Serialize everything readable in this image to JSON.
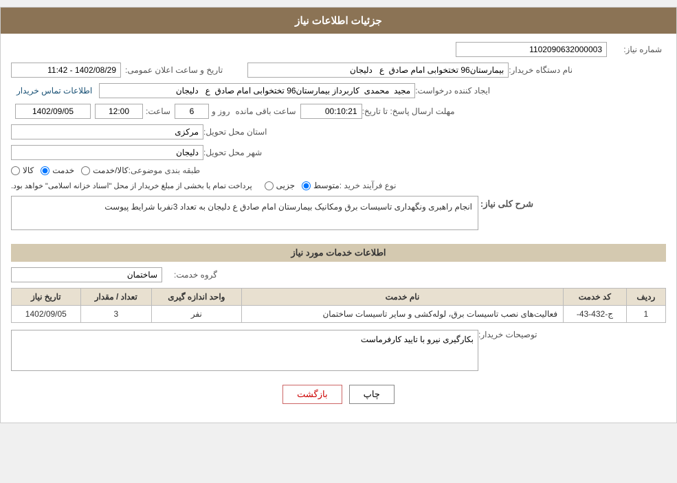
{
  "header": {
    "title": "جزئیات اطلاعات نیاز"
  },
  "fields": {
    "need_number_label": "شماره نیاز:",
    "need_number_value": "1102090632000003",
    "buyer_name_label": "نام دستگاه خریدار:",
    "buyer_name_value": "بیمارستان96 تختخوابی امام صادق  ع   دلیجان",
    "creator_label": "ایجاد کننده درخواست:",
    "creator_value": "مجید  محمدی  کاربرداز بیمارستان96 تختخوابی امام صادق  ع   دلیجان",
    "contact_link": "اطلاعات تماس خریدار",
    "deadline_label": "مهلت ارسال پاسخ: تا تاریخ:",
    "date_value": "1402/09/05",
    "time_label": "ساعت:",
    "time_value": "12:00",
    "days_label": "روز و",
    "days_value": "6",
    "remaining_label": "ساعت باقی مانده",
    "remaining_value": "00:10:21",
    "province_label": "استان محل تحویل:",
    "province_value": "مرکزی",
    "city_label": "شهر محل تحویل:",
    "city_value": "دلیجان",
    "date_announce_label": "تاریخ و ساعت اعلان عمومی:",
    "date_announce_value": "1402/08/29 - 11:42",
    "category_label": "طبقه بندی موضوعی:",
    "category_options": [
      "کالا",
      "خدمت",
      "کالا/خدمت"
    ],
    "category_selected": "خدمت",
    "process_label": "نوع فرآیند خرید :",
    "process_options": [
      "جزیی",
      "متوسط"
    ],
    "process_selected": "متوسط",
    "process_note": "پرداخت تمام یا بخشی از مبلغ خریدار از محل \"اسناد خزانه اسلامی\" خواهد بود.",
    "description_section": "شرح کلی نیاز:",
    "description_value": "انجام راهبری ونگهداری تاسیسات برق ومکانیک بیمارستان امام صادق ع دلیجان به تعداد 3نفربا شرایط پیوست",
    "services_section": "اطلاعات خدمات مورد نیاز",
    "service_group_label": "گروه خدمت:",
    "service_group_value": "ساختمان",
    "table_headers": [
      "ردیف",
      "کد خدمت",
      "نام خدمت",
      "واحد اندازه گیری",
      "تعداد / مقدار",
      "تاریخ نیاز"
    ],
    "table_rows": [
      {
        "row": "1",
        "code": "ج-432-43-",
        "name": "فعالیت‌های نصب تاسیسات برق، لوله‌کشی و سایر تاسیسات ساختمان",
        "unit": "نفر",
        "count": "3",
        "date": "1402/09/05"
      }
    ],
    "buyer_notes_label": "توصیحات خریدار:",
    "buyer_notes_value": "بکارگیری نیرو با تایید کارفرماست",
    "btn_print": "چاپ",
    "btn_back": "بازگشت"
  }
}
